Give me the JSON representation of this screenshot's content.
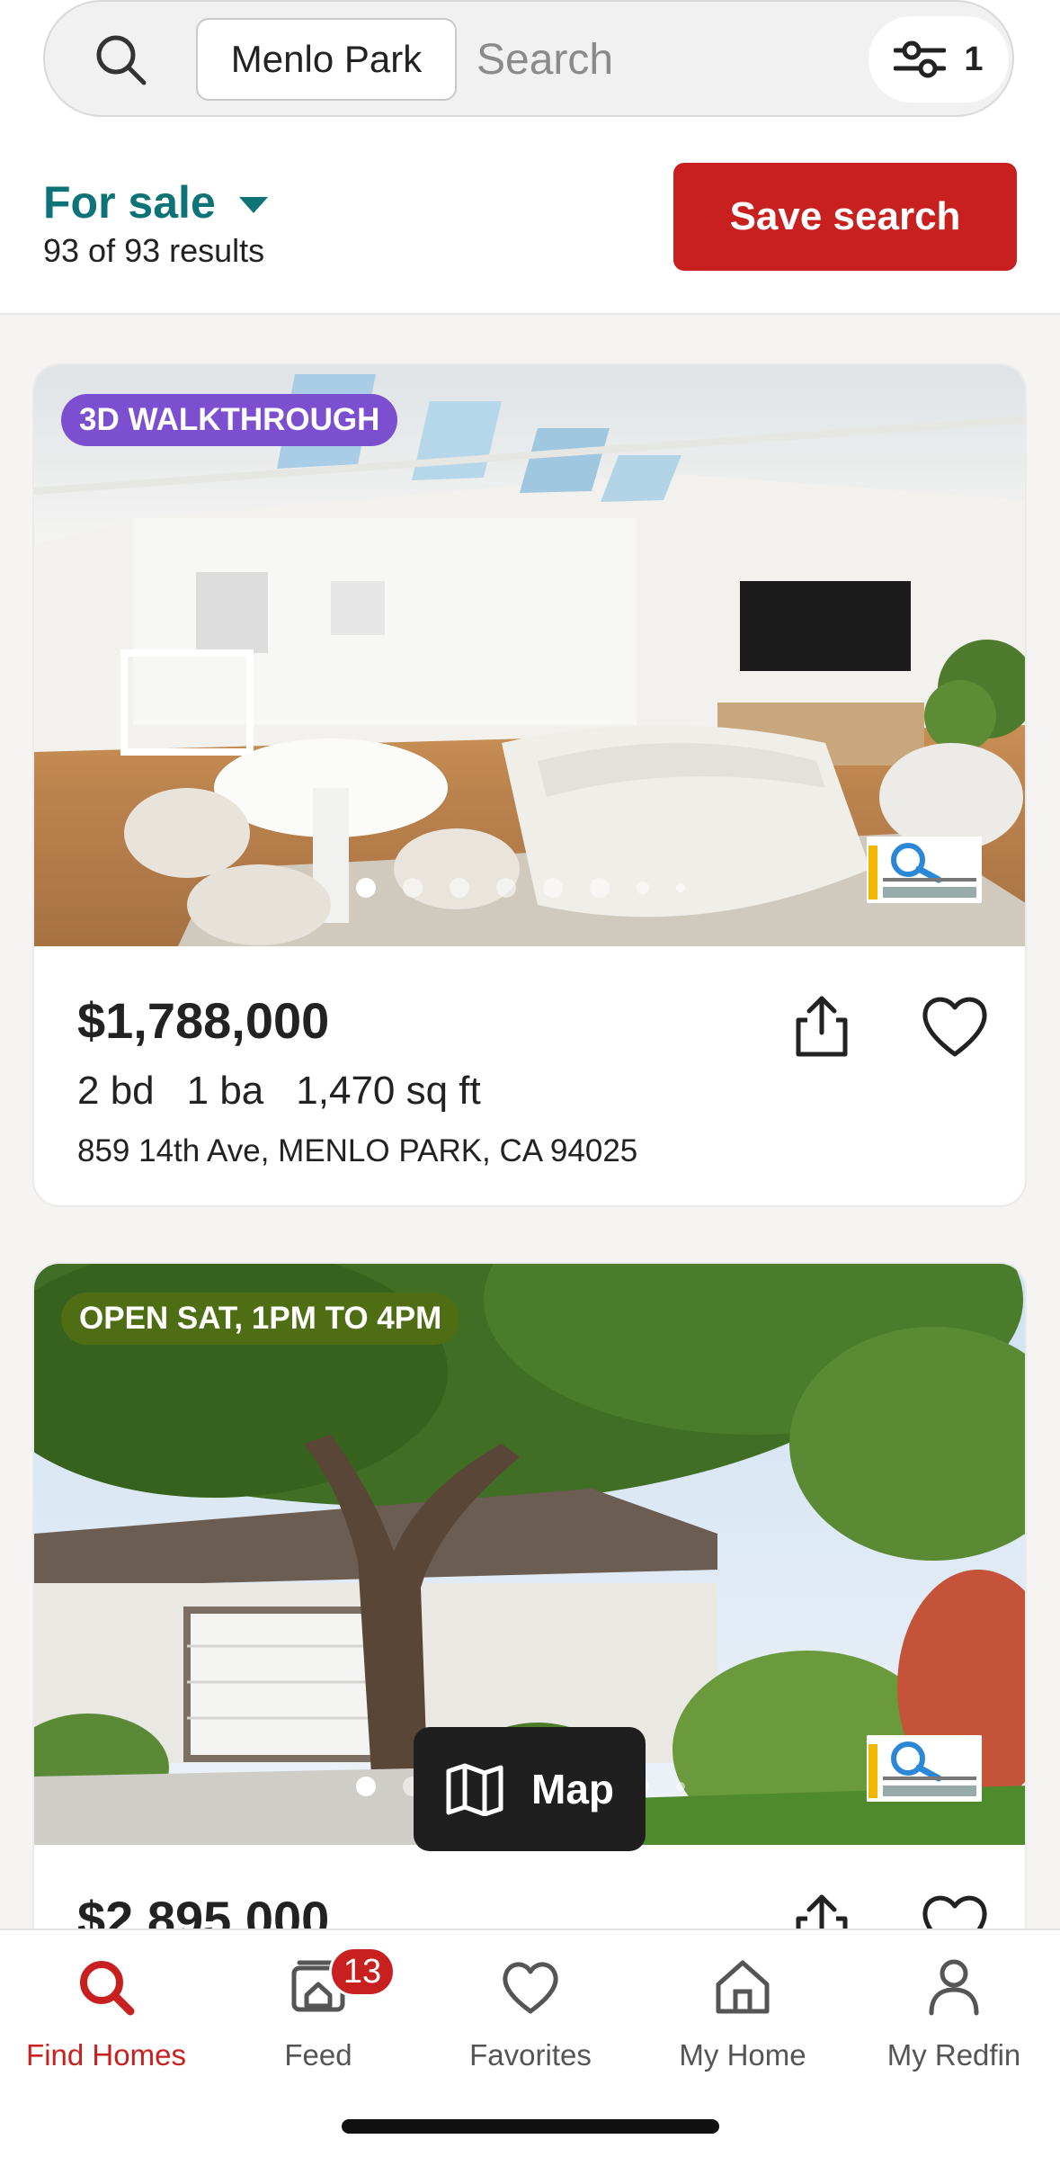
{
  "search": {
    "location_chip": "Menlo Park",
    "placeholder": "Search",
    "filter_count": "1"
  },
  "status": {
    "label": "For sale",
    "results": "93 of 93 results"
  },
  "save_search_label": "Save search",
  "listings": [
    {
      "badge": "3D WALKTHROUGH",
      "badge_color": "#7c4fd1",
      "price": "$1,788,000",
      "beds": "2 bd",
      "baths": "1 ba",
      "sqft": "1,470 sq ft",
      "address": "859 14th Ave, MENLO PARK, CA 94025",
      "photo_count_dots": 8,
      "active_photo": 1
    },
    {
      "badge": "OPEN SAT, 1PM TO 4PM",
      "badge_color": "#4f6e14",
      "price": "$2,895,000",
      "photo_count_dots": 8,
      "active_photo": 1
    }
  ],
  "map_button_label": "Map",
  "nav": {
    "find_homes": "Find Homes",
    "feed": "Feed",
    "feed_badge": "13",
    "favorites": "Favorites",
    "my_home": "My Home",
    "my_redfin": "My Redfin"
  },
  "colors": {
    "brand_red": "#c8201f",
    "teal": "#0d7377"
  }
}
